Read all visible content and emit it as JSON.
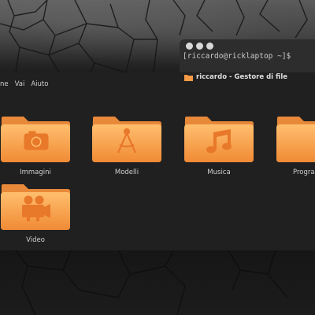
{
  "terminal": {
    "prompt": "[riccardo@ricklaptop ~]$"
  },
  "file_manager": {
    "title": "riccardo - Gestore di file",
    "menu": [
      "ne",
      "Vai",
      "Aiuto"
    ],
    "folders": [
      {
        "label": "Immagini",
        "icon": "camera-icon"
      },
      {
        "label": "Modelli",
        "icon": "compass-icon"
      },
      {
        "label": "Musica",
        "icon": "music-note-icon"
      },
      {
        "label": "Progra",
        "icon": "folder-icon"
      },
      {
        "label": "Video",
        "icon": "film-camera-icon"
      }
    ]
  },
  "colors": {
    "folder_orange": "#f59a45",
    "folder_orange_light": "#ffb968",
    "background": "#202020"
  }
}
